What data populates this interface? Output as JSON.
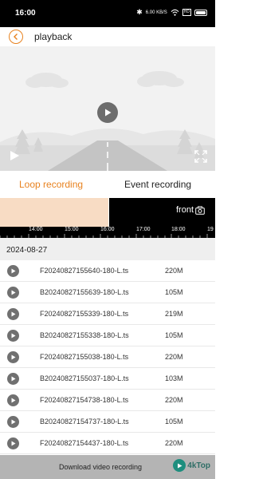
{
  "status_bar": {
    "time": "16:00",
    "network_speed": "6.00 KB/S",
    "box_label": "HD"
  },
  "header": {
    "title": "playback"
  },
  "video": {
    "play_icon": "play-icon",
    "fullscreen_icon": "fullscreen-icon"
  },
  "tabs": {
    "loop": "Loop recording",
    "event": "Event recording",
    "active_color": "#e8821f"
  },
  "timeline": {
    "camera_label": "front",
    "labels": [
      "14:00",
      "15:00",
      "16:00",
      "17:00",
      "18:00",
      "19"
    ]
  },
  "date": "2024-08-27",
  "recordings": [
    {
      "name": "F20240827155640-180-L.ts",
      "size": "220M"
    },
    {
      "name": "B20240827155639-180-L.ts",
      "size": "105M"
    },
    {
      "name": "F20240827155339-180-L.ts",
      "size": "219M"
    },
    {
      "name": "B20240827155338-180-L.ts",
      "size": "105M"
    },
    {
      "name": "F20240827155038-180-L.ts",
      "size": "220M"
    },
    {
      "name": "B20240827155037-180-L.ts",
      "size": "103M"
    },
    {
      "name": "F20240827154738-180-L.ts",
      "size": "220M"
    },
    {
      "name": "B20240827154737-180-L.ts",
      "size": "105M"
    },
    {
      "name": "F20240827154437-180-L.ts",
      "size": "220M"
    }
  ],
  "footer": {
    "download_label": "Download video recording",
    "watermark": "4kTop"
  }
}
